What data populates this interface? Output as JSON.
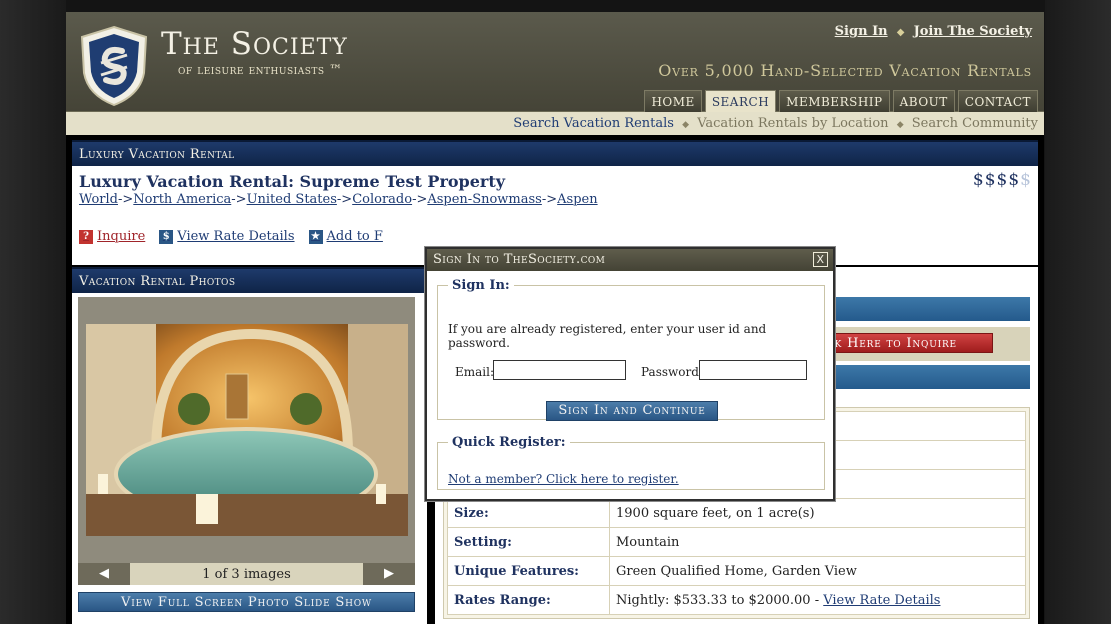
{
  "header": {
    "title": "The Society",
    "subtitle": "of leisure enthusiasts ™",
    "sign_in": "Sign In",
    "join": "Join The Society",
    "tagline": "Over 5,000 Hand-Selected Vacation Rentals",
    "link_sep": "◆"
  },
  "nav": {
    "tabs": [
      "HOME",
      "SEARCH",
      "MEMBERSHIP",
      "ABOUT",
      "CONTACT"
    ],
    "active": "SEARCH"
  },
  "subnav": {
    "search_rentals": "Search Vacation Rentals",
    "by_location": "Vacation Rentals by Location",
    "search_community": "Search Community",
    "sep": "◆"
  },
  "rental": {
    "section_title": "Luxury Vacation Rental",
    "title": "Luxury Vacation Rental: Supreme Test Property",
    "price_on": "$$$$",
    "price_off": "$",
    "breadcrumb": [
      "World",
      "North America",
      "United States",
      "Colorado",
      "Aspen-Snowmass",
      "Aspen"
    ],
    "breadcrumb_sep": "->",
    "actions": {
      "inquire": "Inquire",
      "rates": "View Rate Details",
      "add": "Add to F"
    }
  },
  "photos": {
    "section_title": "Vacation Rental Photos",
    "count": "1 of 3 images",
    "prev": "◀",
    "next": "▶",
    "slideshow": "View Full Screen Photo Slide Show"
  },
  "right": {
    "inquire_button": "Click Here to Inquire",
    "details": [
      {
        "key": "Size:",
        "value": "1900 square feet, on 1 acre(s)"
      },
      {
        "key": "Setting:",
        "value": "Mountain"
      },
      {
        "key": "Unique Features:",
        "value": "Green Qualified Home, Garden View"
      },
      {
        "key": "Rates Range:",
        "value": "Nightly: $533.33 to $2000.00 - ",
        "link": "View Rate Details"
      }
    ]
  },
  "modal": {
    "title": "Sign In to TheSociety.com",
    "close": "X",
    "signin_legend": "Sign In:",
    "signin_text": "If you are already registered, enter your user id and password.",
    "email_label": "Email:",
    "email_value": "",
    "password_label": "Password:",
    "password_value": "",
    "signin_button": "Sign In and Continue",
    "register_legend": "Quick Register:",
    "register_link": "Not a member? Click here to register."
  },
  "colors": {
    "navy": "#1f3260",
    "header_olive": "#4f4e40",
    "accent_red": "#b52a2a",
    "button_blue": "#2a5685"
  }
}
